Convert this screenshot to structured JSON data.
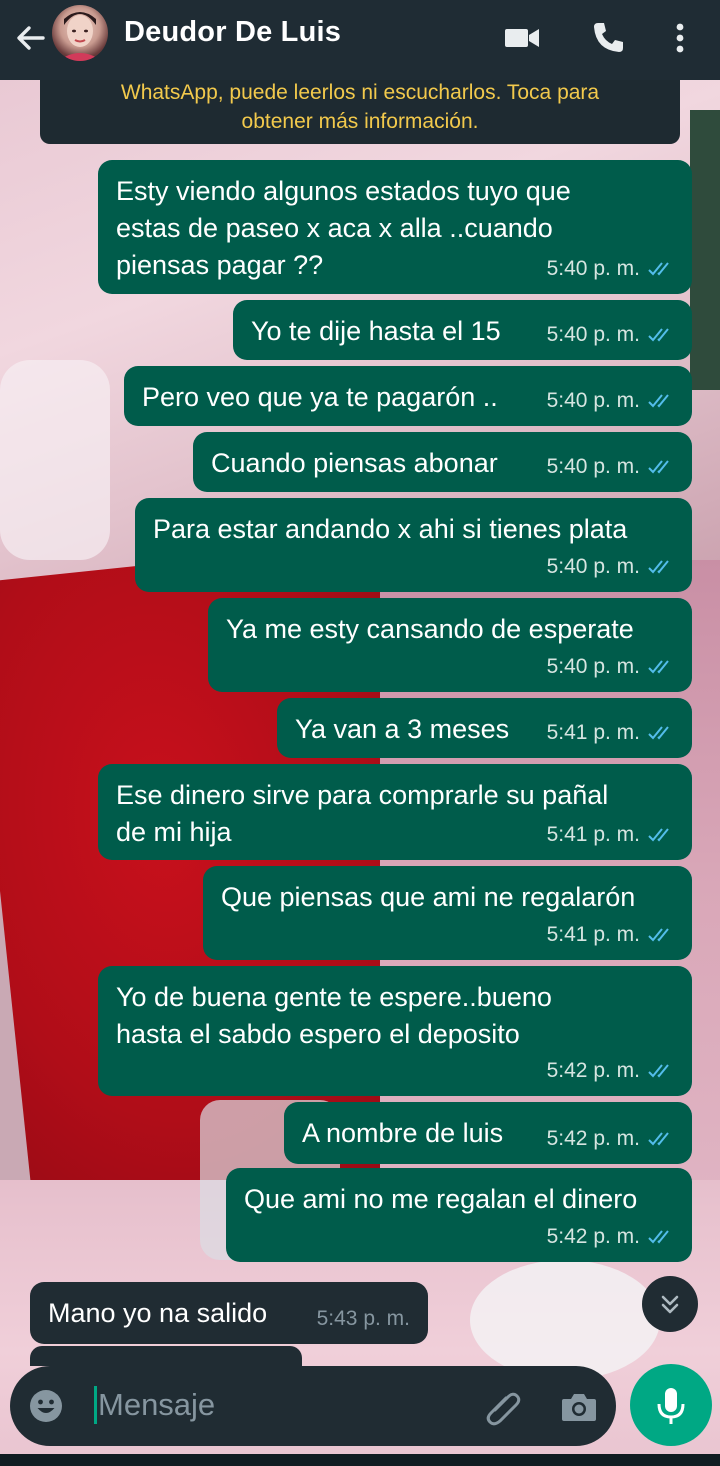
{
  "header": {
    "contact_name": "Deudor De Luis",
    "icons": [
      "back-arrow-icon",
      "video-call-icon",
      "phone-icon",
      "more-vert-icon"
    ]
  },
  "notice": {
    "line1": "WhatsApp, puede leerlos ni escucharlos. Toca para",
    "line2": "obtener más información."
  },
  "messages": [
    {
      "dir": "out",
      "lines": [
        "Esty viendo algunos estados tuyo que",
        "estas de paseo x aca x alla ..cuando",
        "piensas pagar ??"
      ],
      "time": "5:40 p. m."
    },
    {
      "dir": "out",
      "lines": [
        "Yo te dije hasta el 15"
      ],
      "time": "5:40 p. m."
    },
    {
      "dir": "out",
      "lines": [
        "Pero veo que ya te pagarón .."
      ],
      "time": "5:40 p. m."
    },
    {
      "dir": "out",
      "lines": [
        "Cuando piensas abonar"
      ],
      "time": "5:40 p. m."
    },
    {
      "dir": "out",
      "lines": [
        "Para estar andando x ahi si tienes plata"
      ],
      "time": "5:40 p. m."
    },
    {
      "dir": "out",
      "lines": [
        "Ya me esty cansando de esperate"
      ],
      "time": "5:40 p. m."
    },
    {
      "dir": "out",
      "lines": [
        "Ya van a 3 meses"
      ],
      "time": "5:41 p. m."
    },
    {
      "dir": "out",
      "lines": [
        "Ese dinero sirve para comprarle su pañal",
        "de mi hija"
      ],
      "time": "5:41 p. m."
    },
    {
      "dir": "out",
      "lines": [
        "Que piensas que ami ne regalarón"
      ],
      "time": "5:41 p. m."
    },
    {
      "dir": "out",
      "lines": [
        "Yo de buena gente te espere..bueno",
        "hasta el sabdo espero el deposito"
      ],
      "time": "5:42 p. m."
    },
    {
      "dir": "out",
      "lines": [
        "A nombre de luis"
      ],
      "time": "5:42 p. m."
    },
    {
      "dir": "out",
      "lines": [
        "Que ami no me regalan el dinero"
      ],
      "time": "5:42 p. m."
    },
    {
      "dir": "in",
      "lines": [
        "Mano yo na salido"
      ],
      "time": "5:43 p. m."
    }
  ],
  "input": {
    "placeholder": "Mensaje"
  },
  "colors": {
    "header_bg": "#1f2c34",
    "outgoing_bubble": "#005c4b",
    "incoming_bubble": "#202c33",
    "read_ticks": "#53bdeb",
    "accent": "#00a884",
    "notice_text": "#f2c94c"
  }
}
